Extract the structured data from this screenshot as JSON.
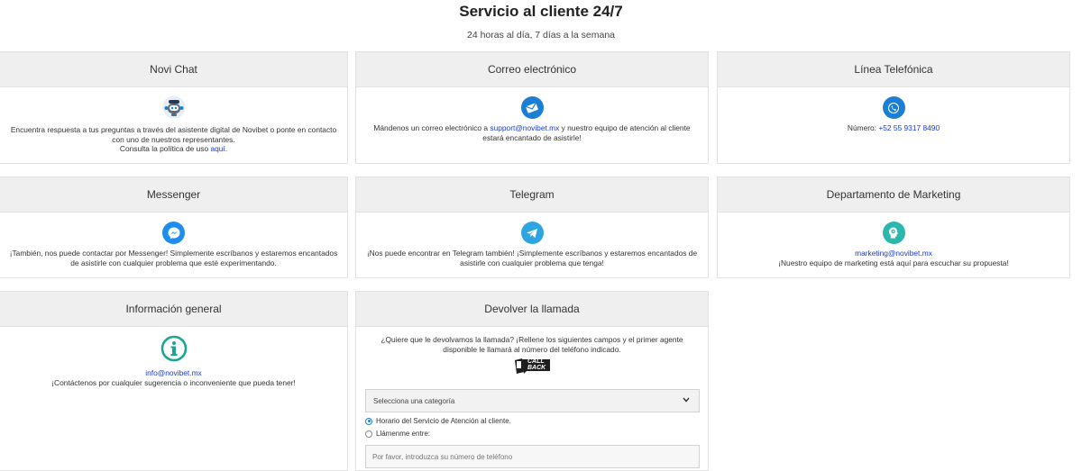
{
  "header": {
    "title": "Servicio al cliente 24/7",
    "subtitle": "24 horas al día, 7 días a la semana"
  },
  "cards": {
    "novichat": {
      "title": "Novi Chat",
      "line1": "Encuentra respuesta a tus preguntas a través del asistente digital de Novibet o ponte en contacto con uno de nuestros representantes.",
      "line2_prefix": "Consulta la política de uso ",
      "line2_link": "aquí",
      "line2_suffix": ".",
      "icon": "chatbot-icon"
    },
    "email": {
      "title": "Correo electrónico",
      "text_prefix": "Mándenos un correo electrónico a ",
      "link": "support@novibet.mx",
      "text_suffix": " y nuestro equipo de atención al cliente estará encantado de asistirle!",
      "icon": "envelope-icon"
    },
    "phone": {
      "title": "Línea Telefónica",
      "label": "Número: ",
      "number": "+52 55 9317 8490",
      "icon": "phone-icon"
    },
    "messenger": {
      "title": "Messenger",
      "text": "¡También, nos puede contactar por Messenger! Simplemente escríbanos y estaremos encantados de asistirle con cualquier problema que esté experimentando.",
      "icon": "messenger-icon"
    },
    "telegram": {
      "title": "Telegram",
      "text": "¡Nos puede encontrar en Telegram también! ¡Simplemente escríbanos y estaremos encantados de asistirle con cualquier problema que tenga!",
      "icon": "telegram-icon"
    },
    "marketing": {
      "title": "Departamento de Marketing",
      "link": "marketing@novibet.mx",
      "text": "¡Nuestro equipo de marketing está aquí para escuchar su propuesta!",
      "icon": "idea-head-icon"
    },
    "info": {
      "title": "Información general",
      "link": "info@novibet.mx",
      "text": "¡Contáctenos por cualquier sugerencia o inconveniente que pueda tener!",
      "icon": "info-icon"
    },
    "callback": {
      "title": "Devolver la llamada",
      "text": "¿Quiere que le devolvamos la llamada? ¡Rellene los siguientes campos y el primer agente disponible le llamará al número del teléfono indicado.",
      "badge_line1": "CALL",
      "badge_line2": "BACK",
      "select_value": "Selecciona una categoría",
      "radio1": "Horario del Servicio de Atención al cliente.",
      "radio2": "Llámenme entre:",
      "phone_placeholder": "Por favor, introduzca su número de teléfono"
    }
  },
  "colors": {
    "accent": "#1d7fd4",
    "link": "#1a3adb",
    "header_bg": "#efefef"
  }
}
